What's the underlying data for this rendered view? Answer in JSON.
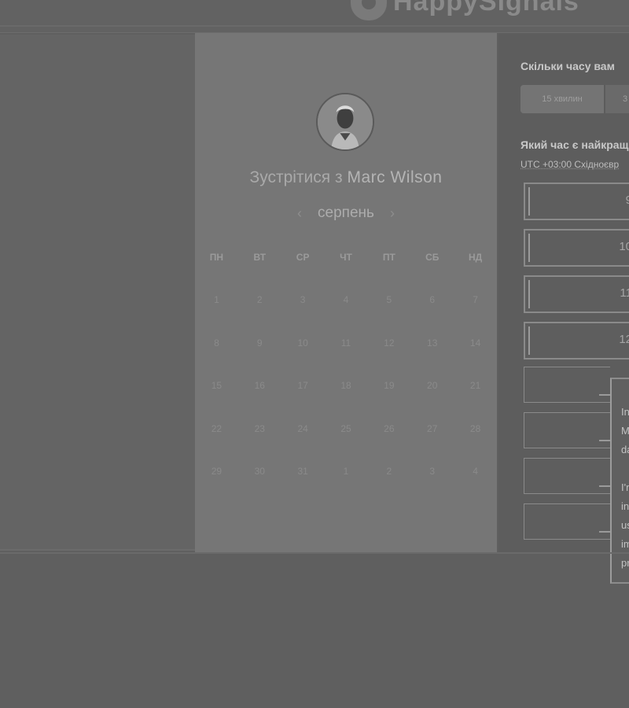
{
  "header": {
    "logo_text": "HappySignals",
    "colors": {
      "page_bg": "#5f5f5f",
      "card_bg": "#767676"
    }
  },
  "calendar": {
    "title_prefix": "Зустрітися з",
    "person_name": "Marc Wilson",
    "month": "серпень",
    "prev_icon": "‹",
    "next_icon": "›",
    "weekdays": [
      "ПН",
      "ВТ",
      "СР",
      "ЧТ",
      "ПТ",
      "СБ",
      "НД"
    ],
    "days": [
      "1",
      "2",
      "3",
      "4",
      "5",
      "6",
      "7",
      "8",
      "9",
      "10",
      "11",
      "12",
      "13",
      "14",
      "15",
      "16",
      "17",
      "18",
      "19",
      "20",
      "21",
      "22",
      "23",
      "24",
      "25",
      "26",
      "27",
      "28",
      "29",
      "30",
      "31",
      "1",
      "2",
      "3",
      "4"
    ]
  },
  "duration": {
    "question": "Скільки часу вам",
    "options": [
      "15 хвилин",
      "3"
    ]
  },
  "time": {
    "question": "Який час є найкращ",
    "timezone": "UTC +03:00 Східноєвр",
    "slots": [
      "9",
      "10",
      "11",
      "12"
    ]
  },
  "popover": {
    "paragraph1": "In\nM\nda",
    "paragraph2": "I'r\nin\nus\nim\npr"
  }
}
